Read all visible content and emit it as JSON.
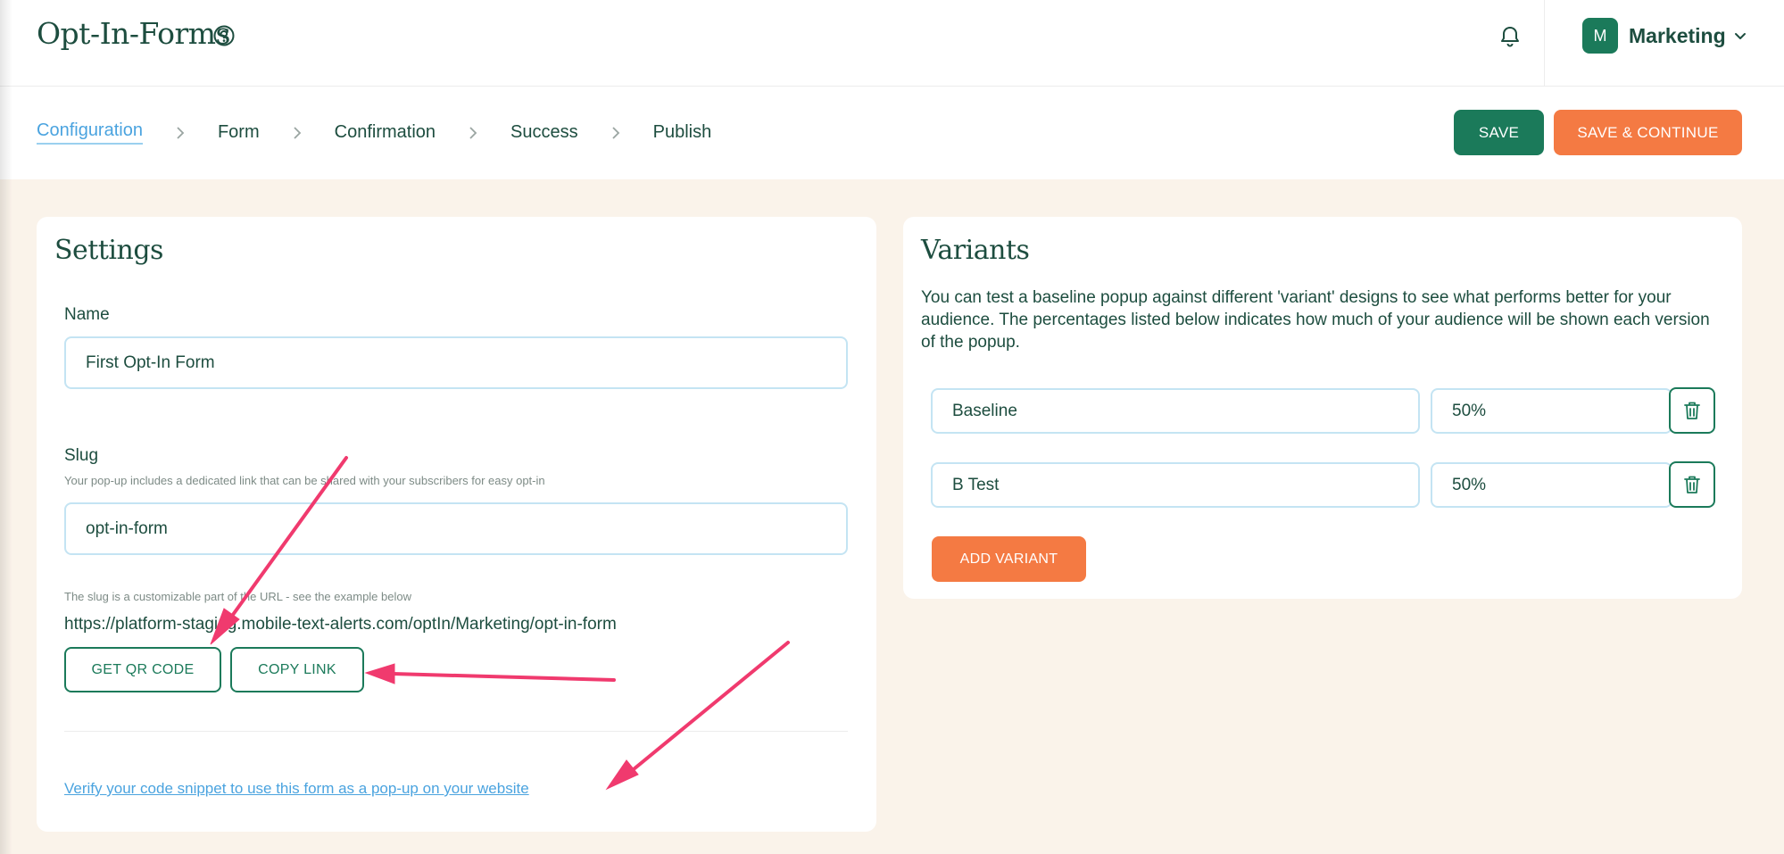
{
  "header": {
    "app_title": "Opt-In-Forms",
    "account": {
      "avatar_initial": "M",
      "name": "Marketing"
    }
  },
  "steps": [
    "Configuration",
    "Form",
    "Confirmation",
    "Success",
    "Publish"
  ],
  "active_step": "Configuration",
  "actions": {
    "save": "SAVE",
    "save_continue": "SAVE & CONTINUE"
  },
  "settings": {
    "title": "Settings",
    "name_label": "Name",
    "name_value": "First Opt-In Form",
    "slug_label": "Slug",
    "slug_help": "Your pop-up includes a dedicated link that can be shared with your subscribers for easy opt-in",
    "slug_value": "opt-in-form",
    "slug_note": "The slug is a customizable part of the URL - see the example below",
    "url": "https://platform-staging.mobile-text-alerts.com/optIn/Marketing/opt-in-form",
    "qr_button": "GET QR CODE",
    "copy_button": "COPY LINK",
    "verify_link": "Verify your code snippet to use this form as a pop-up on your website"
  },
  "variants": {
    "title": "Variants",
    "description": "You can test a baseline popup against different 'variant' designs to see what performs better for your audience. The percentages listed below indicates how much of your audience will be shown each version of the popup.",
    "rows": [
      {
        "name": "Baseline",
        "percent": "50%"
      },
      {
        "name": "B Test",
        "percent": "50%"
      }
    ],
    "add_button": "ADD VARIANT"
  },
  "colors": {
    "brand_green": "#1b7a5a",
    "accent_orange": "#f47a43",
    "link_blue": "#4aa3df",
    "annotation_pink": "#f03a6e",
    "background": "#faf3ea"
  }
}
